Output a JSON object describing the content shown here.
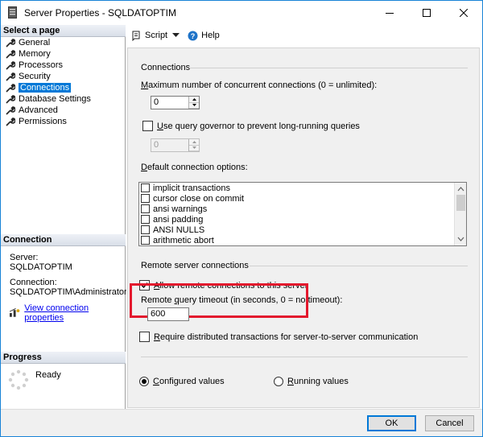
{
  "window": {
    "title": "Server Properties - SQLDATOPTIM",
    "minimize": "—",
    "maximize": "☐",
    "close": "✕"
  },
  "left": {
    "select_page_header": "Select a page",
    "pages": [
      {
        "label": "General"
      },
      {
        "label": "Memory"
      },
      {
        "label": "Processors"
      },
      {
        "label": "Security"
      },
      {
        "label": "Connections"
      },
      {
        "label": "Database Settings"
      },
      {
        "label": "Advanced"
      },
      {
        "label": "Permissions"
      }
    ],
    "selected_page": "Connections",
    "connection_header": "Connection",
    "server_label": "Server:",
    "server_value": "SQLDATOPTIM",
    "connection_label": "Connection:",
    "connection_value": "SQLDATOPTIM\\Administrator",
    "view_props_link": "View connection properties",
    "progress_header": "Progress",
    "progress_status": "Ready"
  },
  "toolbar": {
    "script_label": "Script",
    "help_label": "Help"
  },
  "connections": {
    "group_title": "Connections",
    "max_conn_label_pre": "",
    "max_conn_label_u": "M",
    "max_conn_label_post": "aximum number of concurrent connections (0 = unlimited):",
    "max_conn_value": "0",
    "governor_label_u": "U",
    "governor_label_post": "se query governor to prevent long-running queries",
    "governor_value": "0",
    "default_opts_label_u": "D",
    "default_opts_label_post": "efault connection options:",
    "options": [
      {
        "label": "implicit transactions"
      },
      {
        "label": "cursor close on commit"
      },
      {
        "label": "ansi warnings"
      },
      {
        "label": "ansi padding"
      },
      {
        "label": "ANSI NULLS"
      },
      {
        "label": "arithmetic abort"
      }
    ]
  },
  "remote": {
    "group_title": "Remote server connections",
    "allow_label_u": "A",
    "allow_label_post": "llow remote connections to this server",
    "allow_checked": true,
    "timeout_label_pre": "Remote ",
    "timeout_label_u": "q",
    "timeout_label_post": "uery timeout (in seconds, 0 = no timeout):",
    "timeout_value": "600",
    "require_dist_label_u": "R",
    "require_dist_label_post": "equire distributed transactions for server-to-server communication"
  },
  "values": {
    "configured_label_u": "C",
    "configured_label_post": "onfigured values",
    "running_label_u": "R",
    "running_label_post": "unning values",
    "selected": "configured"
  },
  "buttons": {
    "ok": "OK",
    "cancel": "Cancel"
  },
  "colors": {
    "accent": "#0078d7",
    "highlight_box": "#e3182d"
  }
}
